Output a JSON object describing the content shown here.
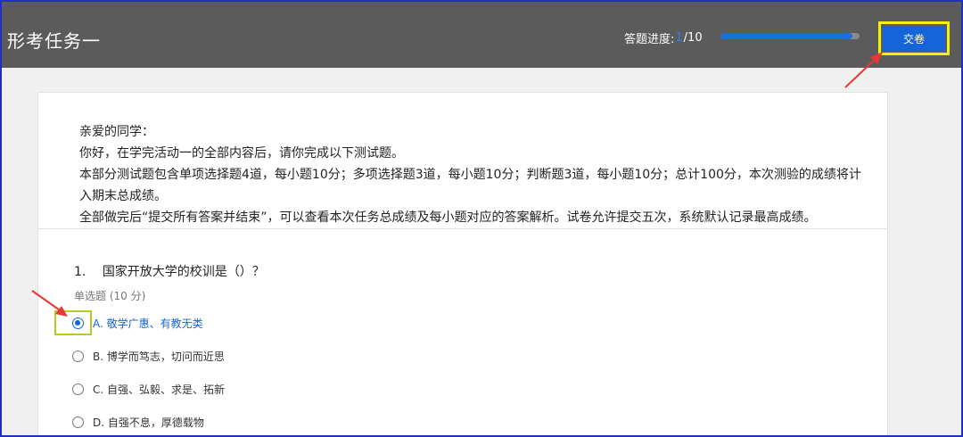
{
  "header": {
    "title": "形考任务一",
    "progress_label": "答题进度:",
    "progress_current": "1",
    "progress_sep_total": "/10",
    "progress_fraction": 0.95,
    "submit_label": "交卷"
  },
  "intro": {
    "lines": [
      "亲爱的同学：",
      "你好，在学完活动一的全部内容后，请你完成以下测试题。",
      "本部分测试题包含单项选择题4道，每小题10分；多项选择题3道，每小题10分；判断题3道，每小题10分；总计100分，本次测验的成绩将计入期末总成绩。",
      "全部做完后“提交所有答案并结束”，可以查看本次任务总成绩及每小题对应的答案解析。试卷允许提交五次，系统默认记录最高成绩。"
    ]
  },
  "question": {
    "number": "1.",
    "text": "国家开放大学的校训是（）？",
    "type": "单选题 (10 分)",
    "options": [
      {
        "label": "A. 敬学广惠、有教无类",
        "selected": true
      },
      {
        "label": "B. 博学而笃志，切问而近思",
        "selected": false
      },
      {
        "label": "C. 自强、弘毅、求是、拓新",
        "selected": false
      },
      {
        "label": "D. 自强不息，厚德载物",
        "selected": false
      }
    ]
  },
  "colors": {
    "header_bg": "#5b5b5b",
    "accent": "#1565d8",
    "highlight_yellow": "#f2f20a",
    "highlight_green": "#b7cc1c",
    "arrow_red": "#e53935"
  }
}
